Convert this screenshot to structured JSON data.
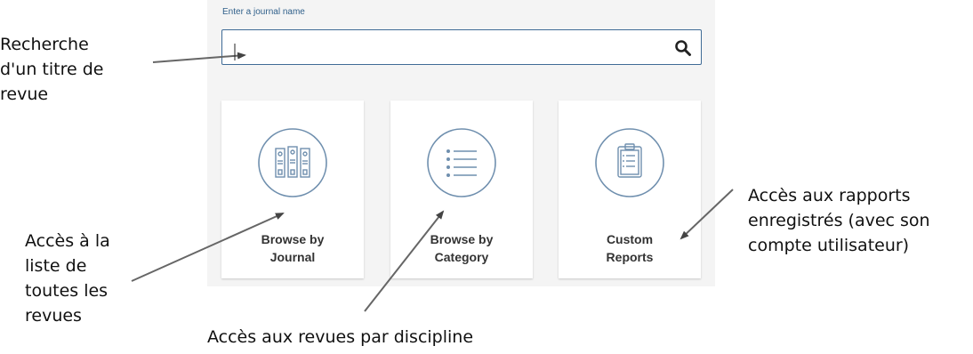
{
  "search": {
    "label": "Enter a journal name",
    "value": "",
    "placeholder": "",
    "icon": "search-icon"
  },
  "tiles": [
    {
      "icon": "journals-binders-icon",
      "line1": "Browse by",
      "line2": "Journal"
    },
    {
      "icon": "list-icon",
      "line1": "Browse by",
      "line2": "Category"
    },
    {
      "icon": "clipboard-icon",
      "line1": "Custom",
      "line2": "Reports"
    }
  ],
  "annotations": {
    "search": [
      "Recherche",
      "d'un titre de",
      "revue"
    ],
    "journals": [
      "Accès à la",
      "liste de",
      "toutes les",
      "revues"
    ],
    "category": "Accès aux revues par discipline",
    "reports": [
      "Accès aux rapports",
      "enregistrés (avec son",
      "compte utilisateur)"
    ]
  },
  "colors": {
    "accent": "#3f6b96",
    "icon_stroke": "#6f8fae",
    "panel_bg": "#f4f4f4"
  }
}
